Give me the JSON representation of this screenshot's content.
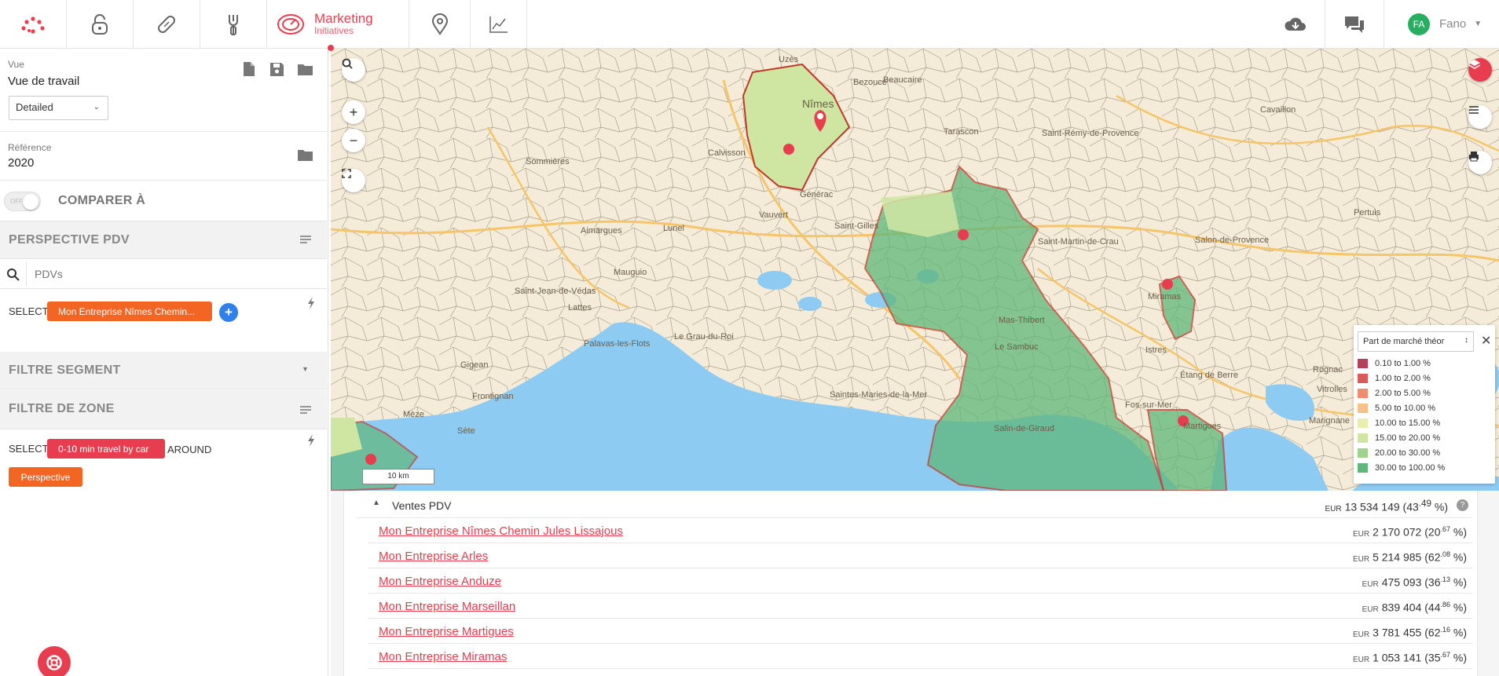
{
  "header": {
    "module_title": "Marketing",
    "module_subtitle": "Initiatives",
    "user_initials": "FA",
    "user_name": "Fano"
  },
  "left_panel": {
    "vue_label": "Vue",
    "vue_value": "Vue de travail",
    "vue_select": "Detailed",
    "reference_label": "Référence",
    "reference_value": "2020",
    "compare_toggle": "OFF",
    "compare_label": "COMPARER À",
    "perspective_header": "PERSPECTIVE PDV",
    "search_placeholder": "PDVs",
    "select_label": "SELECT",
    "pdv_chip": "Mon Entreprise Nîmes Chemin...",
    "segment_header": "FILTRE SEGMENT",
    "zone_header": "FILTRE DE ZONE",
    "zone_select_label": "SELECT",
    "zone_chip": "0-10 min travel by car",
    "around_label": "AROUND",
    "perspective_button": "Perspective"
  },
  "map": {
    "scale_label": "10 km",
    "labels": [
      "Nîmes",
      "Tarascon",
      "Saint-Rémy-de-Provence",
      "Saint-Gilles",
      "Saint-Martin-de-Crau",
      "Vauvert",
      "Lunel",
      "Mauguio",
      "Lattes",
      "Palavas-les-Flots",
      "Frontignan",
      "Sète",
      "Mèze",
      "Salon-de-Provence",
      "Istres",
      "Martigues",
      "Miramas",
      "Fos-sur-Mer",
      "Saintes-Maries-de-la-Mer",
      "Mas-Thibert",
      "Le Sambuc",
      "Salin-de-Giraud",
      "Étang de Berre",
      "Cavaillon",
      "Pertuis",
      "Marignane",
      "Vitrolles",
      "Rognac",
      "Aimargues",
      "Gigean",
      "Saint-Jean-de-Védas",
      "Le Grau-du-Roi",
      "Calvisson",
      "Sommières",
      "Générac",
      "Beaucaire",
      "Bezouce",
      "Uzès"
    ],
    "legend": {
      "selector": "Part de marché théor",
      "items": [
        {
          "label": "0.10 to 1.00 %",
          "color": "#b5405a"
        },
        {
          "label": "1.00 to 2.00 %",
          "color": "#d95a5a"
        },
        {
          "label": "2.00 to 5.00 %",
          "color": "#ee8c6e"
        },
        {
          "label": "5.00 to 10.00 %",
          "color": "#f6c08a"
        },
        {
          "label": "10.00 to 15.00 %",
          "color": "#e9edb0"
        },
        {
          "label": "15.00 to 20.00 %",
          "color": "#cfe6a3"
        },
        {
          "label": "20.00 to 30.00 %",
          "color": "#9fd38d"
        },
        {
          "label": "30.00 to 100.00 %",
          "color": "#5fb77a"
        }
      ]
    }
  },
  "sales": {
    "title": "Ventes PDV",
    "total_currency": "EUR",
    "total_value": "13 534 149",
    "total_pct": "(43",
    "total_pct_dec": ".49",
    "total_pct_end": " %)",
    "rows": [
      {
        "name": "Mon Entreprise Nîmes Chemin Jules Lissajous",
        "currency": "EUR",
        "value": "2 170 072",
        "pct": "(20",
        "dec": ".67",
        "end": " %)"
      },
      {
        "name": "Mon Entreprise Arles",
        "currency": "EUR",
        "value": "5 214 985",
        "pct": "(62",
        "dec": ".08",
        "end": " %)"
      },
      {
        "name": "Mon Entreprise Anduze",
        "currency": "EUR",
        "value": "475 093",
        "pct": "(36",
        "dec": ".13",
        "end": " %)"
      },
      {
        "name": "Mon Entreprise Marseillan",
        "currency": "EUR",
        "value": "839 404",
        "pct": "(44",
        "dec": ".86",
        "end": " %)"
      },
      {
        "name": "Mon Entreprise Martigues",
        "currency": "EUR",
        "value": "3 781 455",
        "pct": "(62",
        "dec": ".16",
        "end": " %)"
      },
      {
        "name": "Mon Entreprise Miramas",
        "currency": "EUR",
        "value": "1 053 141",
        "pct": "(35",
        "dec": ".67",
        "end": " %)"
      }
    ]
  },
  "colors": {
    "accent": "#e83c4f",
    "orange": "#f26522",
    "blue": "#2f80ed",
    "sea": "#8ecbf2"
  }
}
